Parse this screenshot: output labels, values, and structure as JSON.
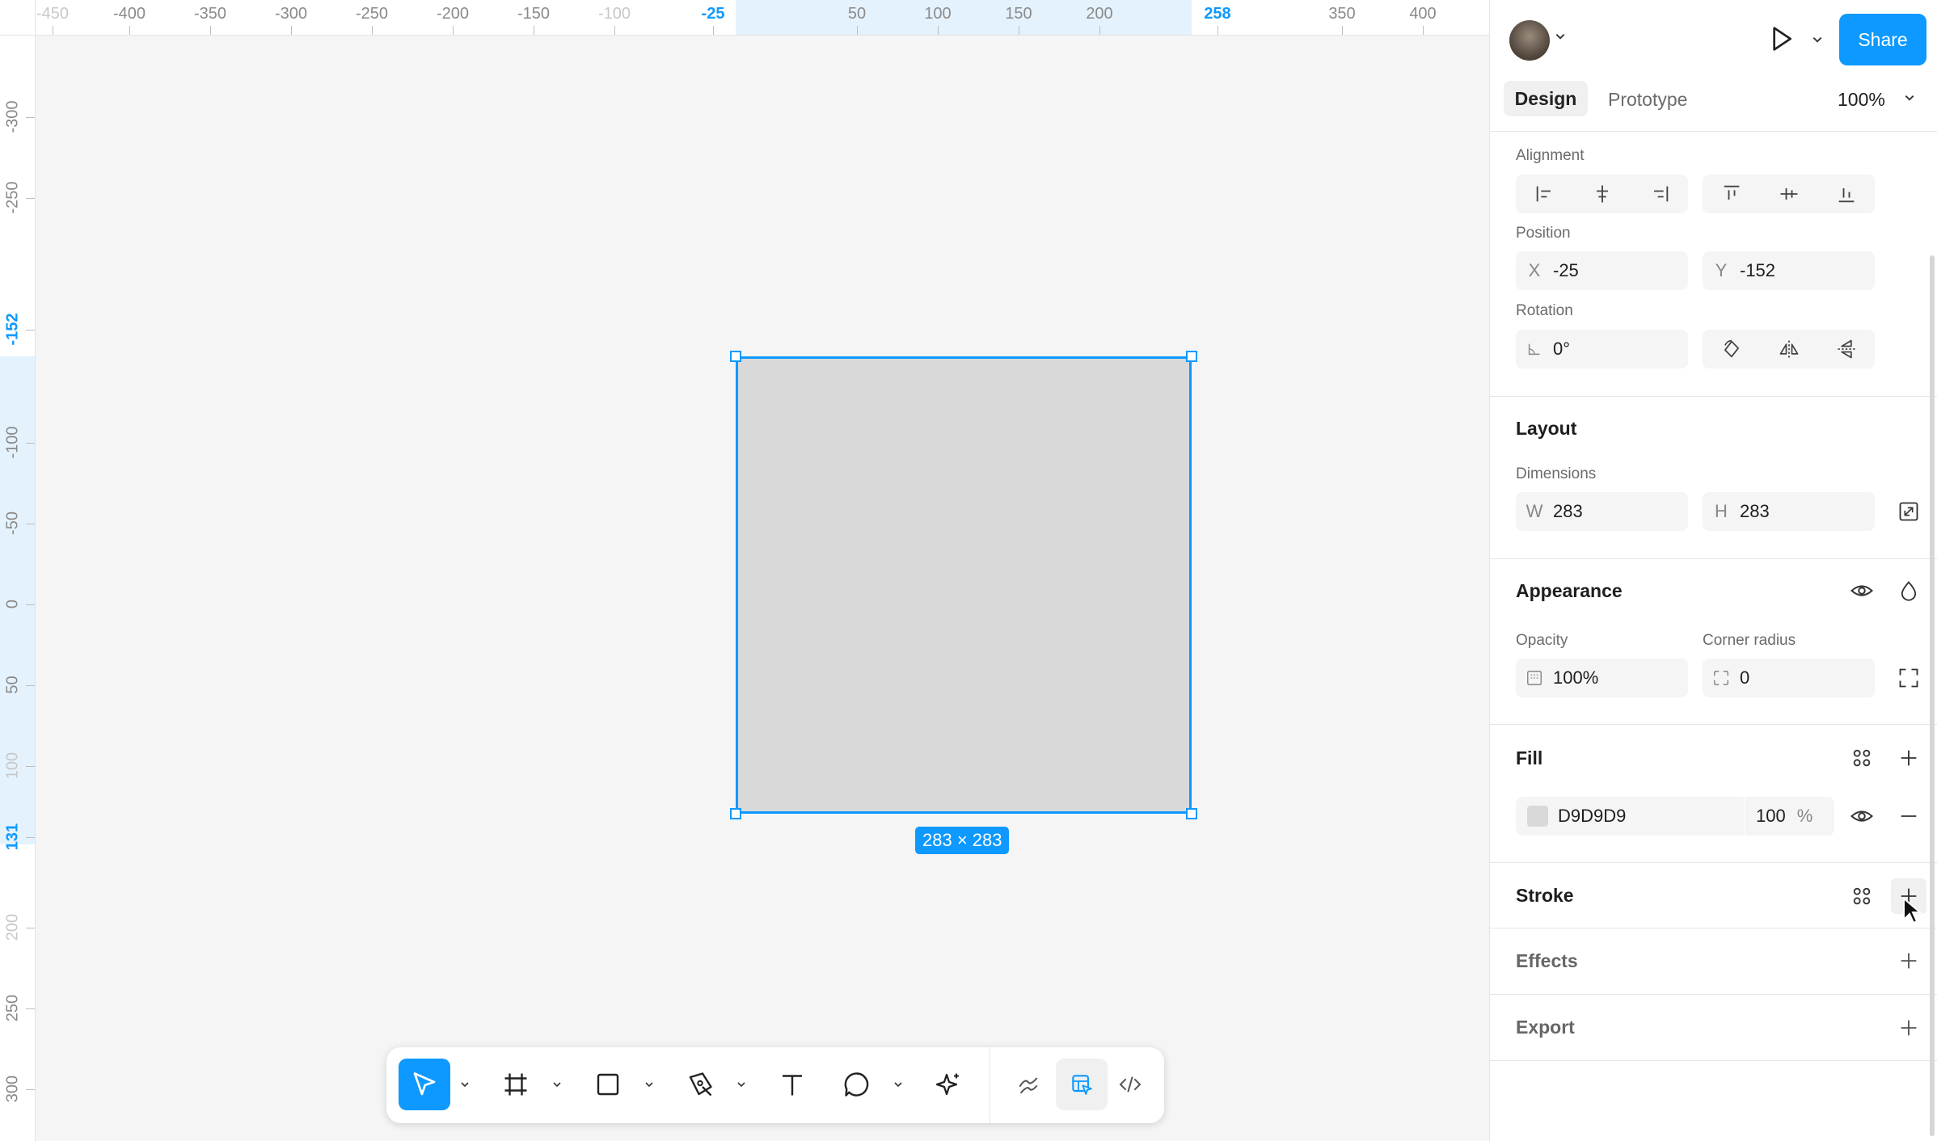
{
  "ruler_top": {
    "labels": [
      "-450",
      "-400",
      "-350",
      "-300",
      "-250",
      "-200",
      "-150",
      "-100",
      "-25",
      "50",
      "100",
      "150",
      "200",
      "258",
      "350",
      "400"
    ],
    "faded": [
      "-450",
      "-100"
    ],
    "accent": [
      "-25",
      "258"
    ]
  },
  "ruler_left": {
    "labels": [
      "-300",
      "-250",
      "-152",
      "-100",
      "-50",
      "0",
      "50",
      "100",
      "131",
      "200",
      "250",
      "300"
    ],
    "faded": [
      "100",
      "200"
    ],
    "accent": [
      "-152",
      "131"
    ]
  },
  "selection": {
    "size_label": "283 × 283",
    "fill": "#D9D9D9",
    "accent": "#0D99FF"
  },
  "toolbar": {
    "tools": [
      "move-tool",
      "frame-tool",
      "rectangle-tool",
      "pen-tool",
      "text-tool",
      "comment-tool",
      "ai-actions-tool",
      "draw-mode",
      "design-mode",
      "dev-mode"
    ],
    "active": "move-tool"
  },
  "header": {
    "share_label": "Share",
    "tab_design": "Design",
    "tab_prototype": "Prototype",
    "zoom": "100%"
  },
  "alignment": {
    "title": "Alignment"
  },
  "position": {
    "title": "Position",
    "x_label": "X",
    "x_value": "-25",
    "y_label": "Y",
    "y_value": "-152"
  },
  "rotation": {
    "title": "Rotation",
    "value": "0°"
  },
  "layout": {
    "title": "Layout",
    "dimensions_label": "Dimensions",
    "w_label": "W",
    "w_value": "283",
    "h_label": "H",
    "h_value": "283"
  },
  "appearance": {
    "title": "Appearance",
    "opacity_label": "Opacity",
    "opacity_value": "100%",
    "radius_label": "Corner radius",
    "radius_value": "0"
  },
  "fill": {
    "title": "Fill",
    "hex": "D9D9D9",
    "opacity": "100",
    "percent": "%",
    "swatch": "#D9D9D9"
  },
  "stroke": {
    "title": "Stroke"
  },
  "effects": {
    "title": "Effects"
  },
  "export": {
    "title": "Export"
  }
}
